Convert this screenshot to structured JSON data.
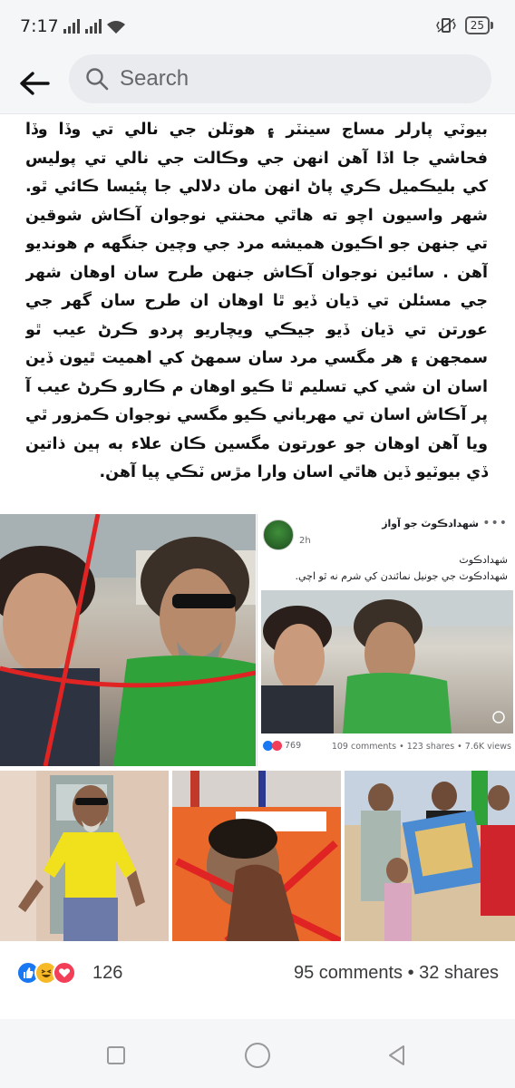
{
  "status_bar": {
    "time": "7:17",
    "battery": "25"
  },
  "search": {
    "placeholder": "Search"
  },
  "post": {
    "text": "بيوٽي پارلر مساج سينٽر ۽ هوٽلن جي نالي تي وڏا وڏا فحاشي جا اڏا آهن انهن جي وڪالت جي نالي تي پوليس کي بليڪميل ڪري پاڻ انهن مان دلالي جا پئيسا ڪائي ٿو. شهر واسيون اچو ته هاٿي محنتي نوجوان آڪاش شوقين تي جنهن جو اڪيون هميشه مرد جي وچين جنگهه م هونديو آهن . سائين نوجوان آڪاش جنهن طرح سان اوهان شهر جي مسئلن تي ڌيان ڏيو ٿا اوهان ان طرح سان گهر جي عورتن تي ڌيان ڏيو جيڪي ويچاريو پردو ڪرڻ عيب ٿو سمجهن ۽ هر مگسي مرد سان سمهڻ کي اهميت ٿيون ڏين اسان ان شي کي تسليم ٿا ڪيو اوهان م ڪارو ڪرڻ عيب آ پر آڪاش اسان تي مهرباني ڪيو مگسي نوجوان ڪمزور ٿي ويا آهن اوهان جو عورتون مگسين ڪان علاء به ٻين ذاتين ڏي بيوٽيو ڏين هاٿي اسان وارا مڙس ٽڪي پيا آهن."
  },
  "embedded_post": {
    "page_name": "شهدادڪوٽ جو آواز",
    "time": "2h",
    "line1": "شهدادڪوٽ",
    "line2": "شهدادڪوٽ جي جونيل نمائندن کي شرم نه ٿو اچي.",
    "reactions": "769",
    "counts": "109 comments • 123 shares • 7.6K views"
  },
  "stats": {
    "reaction_count": "126",
    "comments_shares": "95 comments • 32 shares"
  },
  "icons": {
    "back": "back-arrow-icon",
    "search": "search-icon",
    "like": "like-icon",
    "haha": "haha-icon",
    "love": "love-icon"
  },
  "colors": {
    "like": "#1877f2",
    "love": "#f33e58",
    "haha": "#f7b928",
    "cross": "#e02424"
  }
}
